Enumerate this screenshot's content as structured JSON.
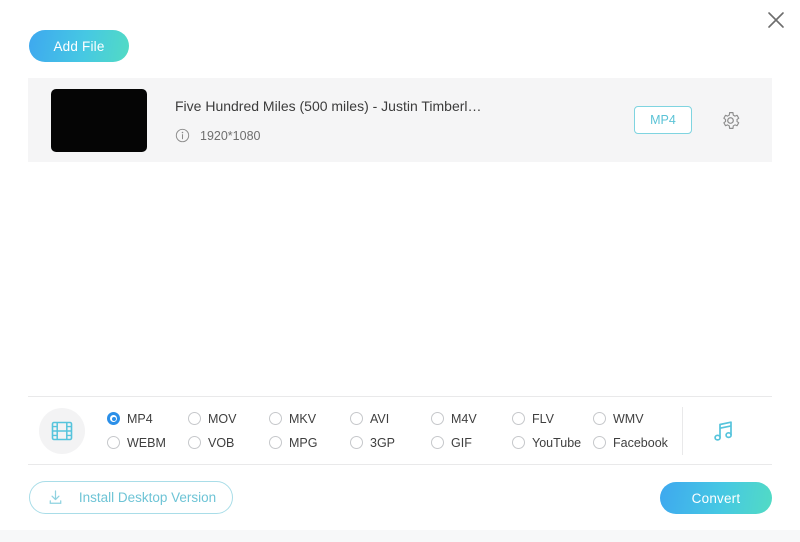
{
  "window": {
    "close_label": "×",
    "close_icon": "close-icon"
  },
  "toolbar": {
    "add_file_label": "Add File",
    "add_file_icon": "add-file-icon"
  },
  "file_list": [
    {
      "title": "Five Hundred Miles (500 miles) - Justin Timberl…",
      "resolution": "1920*1080",
      "info_icon": "info-icon",
      "output_format": "MP4",
      "settings_icon": "gear-icon",
      "thumbnail": "video-thumbnail"
    }
  ],
  "format_bar": {
    "media_icon": "film-strip-icon",
    "audio_icon": "music-note-icon",
    "options": [
      {
        "label": "MP4",
        "selected": true
      },
      {
        "label": "MOV",
        "selected": false
      },
      {
        "label": "MKV",
        "selected": false
      },
      {
        "label": "AVI",
        "selected": false
      },
      {
        "label": "M4V",
        "selected": false
      },
      {
        "label": "FLV",
        "selected": false
      },
      {
        "label": "WMV",
        "selected": false
      },
      {
        "label": "WEBM",
        "selected": false
      },
      {
        "label": "VOB",
        "selected": false
      },
      {
        "label": "MPG",
        "selected": false
      },
      {
        "label": "3GP",
        "selected": false
      },
      {
        "label": "GIF",
        "selected": false
      },
      {
        "label": "YouTube",
        "selected": false
      },
      {
        "label": "Facebook",
        "selected": false
      }
    ]
  },
  "footer": {
    "install_label": "Install Desktop Version",
    "install_icon": "download-icon",
    "convert_label": "Convert"
  },
  "colors": {
    "accent_start": "#3ea8ef",
    "accent_end": "#52dbc4",
    "cyan": "#5bc3d6",
    "radio_selected": "#2b8fe8",
    "card_bg": "#f5f5f6"
  }
}
